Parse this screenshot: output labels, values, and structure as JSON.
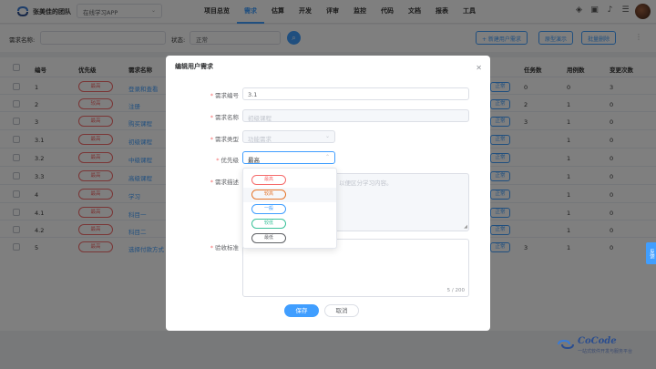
{
  "header": {
    "team": "张美佳的团队",
    "project": "在线学习APP",
    "nav": [
      "项目总览",
      "需求",
      "估算",
      "开发",
      "评审",
      "监控",
      "代码",
      "文档",
      "报表",
      "工具"
    ],
    "active_nav": "需求"
  },
  "filter": {
    "name_label": "需求名称:",
    "name_value": "",
    "status_label": "状态:",
    "status_value": "正常",
    "add_label": "+ 新建用户需求",
    "prototype_label": "原型演示",
    "batch_delete_label": "批量删除"
  },
  "table": {
    "headers": [
      "编号",
      "优先级",
      "需求名称",
      "任务数",
      "用例数",
      "变更次数"
    ],
    "rows": [
      {
        "id": "1",
        "priority": "最高",
        "name": "登录和查看",
        "tasks": "0",
        "cases": "0",
        "changes": "3"
      },
      {
        "id": "2",
        "priority": "较高",
        "name": "注册",
        "tasks": "2",
        "cases": "1",
        "changes": "0"
      },
      {
        "id": "3",
        "priority": "最高",
        "name": "购买课程",
        "tasks": "3",
        "cases": "1",
        "changes": "0"
      },
      {
        "id": "3.1",
        "priority": "最高",
        "name": "初级课程",
        "tasks": "",
        "cases": "1",
        "changes": "0"
      },
      {
        "id": "3.2",
        "priority": "最高",
        "name": "中级课程",
        "tasks": "",
        "cases": "1",
        "changes": "0"
      },
      {
        "id": "3.3",
        "priority": "最高",
        "name": "高级课程",
        "tasks": "",
        "cases": "1",
        "changes": "0"
      },
      {
        "id": "4",
        "priority": "最高",
        "name": "学习",
        "tasks": "",
        "cases": "1",
        "changes": "0"
      },
      {
        "id": "4.1",
        "priority": "最高",
        "name": "科目一",
        "tasks": "",
        "cases": "1",
        "changes": "0"
      },
      {
        "id": "4.2",
        "priority": "最高",
        "name": "科目二",
        "tasks": "",
        "cases": "1",
        "changes": "0"
      },
      {
        "id": "5",
        "priority": "最高",
        "name": "选择付款方式",
        "tasks": "3",
        "cases": "1",
        "changes": "0"
      }
    ],
    "row_tag": "正常"
  },
  "modal": {
    "title": "编辑用户需求",
    "close_icon": "close-icon",
    "fields": {
      "id_label": "需求编号",
      "id_value": "3.1",
      "name_label": "需求名称",
      "name_value": "初级课程",
      "type_label": "需求类型",
      "type_value": "功能需求",
      "priority_label": "优先级",
      "priority_value": "最高",
      "desc_label": "需求描述",
      "desc_placeholder": "以便区分学习内容。",
      "accept_label": "验收标准",
      "accept_counter": "5 / 200"
    },
    "save_label": "保存",
    "cancel_label": "取消"
  },
  "priority_options": [
    {
      "label": "最高",
      "color": "#f56c6c"
    },
    {
      "label": "较高",
      "color": "#e6762b"
    },
    {
      "label": "一般",
      "color": "#409eff"
    },
    {
      "label": "较低",
      "color": "#3cc29a"
    },
    {
      "label": "最低",
      "color": "#606266"
    }
  ],
  "side_tab": "反馈",
  "brand": {
    "name": "CoCode",
    "tagline": "一站式软件开发与服务平台"
  }
}
